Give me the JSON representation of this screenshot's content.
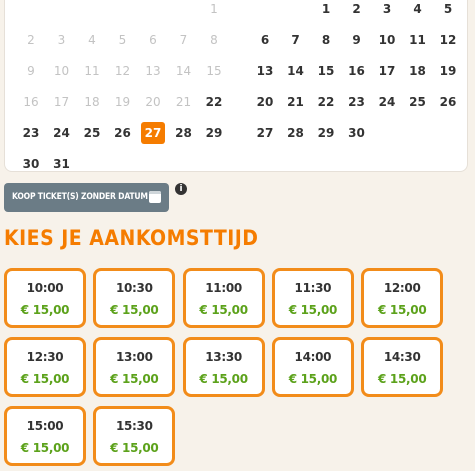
{
  "calendar": {
    "left_month": {
      "rows": [
        [
          {
            "d": ""
          },
          {
            "d": ""
          },
          {
            "d": ""
          },
          {
            "d": ""
          },
          {
            "d": ""
          },
          {
            "d": ""
          },
          {
            "d": "1",
            "m": true
          }
        ],
        [
          {
            "d": "2",
            "m": true
          },
          {
            "d": "3",
            "m": true
          },
          {
            "d": "4",
            "m": true
          },
          {
            "d": "5",
            "m": true
          },
          {
            "d": "6",
            "m": true
          },
          {
            "d": "7",
            "m": true
          },
          {
            "d": "8",
            "m": true
          }
        ],
        [
          {
            "d": "9",
            "m": true
          },
          {
            "d": "10",
            "m": true
          },
          {
            "d": "11",
            "m": true
          },
          {
            "d": "12",
            "m": true
          },
          {
            "d": "13",
            "m": true
          },
          {
            "d": "14",
            "m": true
          },
          {
            "d": "15",
            "m": true
          }
        ],
        [
          {
            "d": "16",
            "m": true
          },
          {
            "d": "17",
            "m": true
          },
          {
            "d": "18",
            "m": true
          },
          {
            "d": "19",
            "m": true
          },
          {
            "d": "20",
            "m": true
          },
          {
            "d": "21",
            "m": true
          },
          {
            "d": "22"
          }
        ],
        [
          {
            "d": "23"
          },
          {
            "d": "24"
          },
          {
            "d": "25"
          },
          {
            "d": "26"
          },
          {
            "d": "27",
            "sel": true
          },
          {
            "d": "28"
          },
          {
            "d": "29"
          }
        ],
        [
          {
            "d": "30"
          },
          {
            "d": "31"
          },
          {
            "d": ""
          },
          {
            "d": ""
          },
          {
            "d": ""
          },
          {
            "d": ""
          },
          {
            "d": ""
          }
        ]
      ]
    },
    "right_month": {
      "rows": [
        [
          {
            "d": ""
          },
          {
            "d": ""
          },
          {
            "d": ""
          },
          {
            "d": "1"
          },
          {
            "d": "2"
          },
          {
            "d": "3"
          },
          {
            "d": "4"
          },
          {
            "d": "5"
          }
        ],
        [
          {
            "d": "6"
          },
          {
            "d": "7"
          },
          {
            "d": "8"
          },
          {
            "d": "9"
          },
          {
            "d": "10"
          },
          {
            "d": "11"
          },
          {
            "d": "12"
          }
        ],
        [
          {
            "d": "13"
          },
          {
            "d": "14"
          },
          {
            "d": "15"
          },
          {
            "d": "16"
          },
          {
            "d": "17"
          },
          {
            "d": "18"
          },
          {
            "d": "19"
          }
        ],
        [
          {
            "d": "20"
          },
          {
            "d": "21"
          },
          {
            "d": "22"
          },
          {
            "d": "23"
          },
          {
            "d": "24"
          },
          {
            "d": "25"
          },
          {
            "d": "26"
          }
        ],
        [
          {
            "d": "27"
          },
          {
            "d": "28"
          },
          {
            "d": "29"
          },
          {
            "d": "30"
          },
          {
            "d": ""
          },
          {
            "d": ""
          },
          {
            "d": ""
          }
        ]
      ]
    }
  },
  "koop_button": {
    "label": "KOOP TICKET(S) ZONDER DATUM",
    "icon": "calendar-icon"
  },
  "info_icon": {
    "glyph": "i"
  },
  "section_title": "KIES JE AANKOMSTTIJD",
  "slots": [
    {
      "time": "10:00",
      "price": "€ 15,00"
    },
    {
      "time": "10:30",
      "price": "€ 15,00"
    },
    {
      "time": "11:00",
      "price": "€ 15,00"
    },
    {
      "time": "11:30",
      "price": "€ 15,00"
    },
    {
      "time": "12:00",
      "price": "€ 15,00"
    },
    {
      "time": "12:30",
      "price": "€ 15,00"
    },
    {
      "time": "13:00",
      "price": "€ 15,00"
    },
    {
      "time": "13:30",
      "price": "€ 15,00"
    },
    {
      "time": "14:00",
      "price": "€ 15,00"
    },
    {
      "time": "14:30",
      "price": "€ 15,00"
    },
    {
      "time": "15:00",
      "price": "€ 15,00"
    },
    {
      "time": "15:30",
      "price": "€ 15,00"
    }
  ],
  "colors": {
    "accent": "#f57c00",
    "slot_border": "#f28c1a",
    "price": "#5ca21b",
    "button_bg": "#6b7c86"
  }
}
